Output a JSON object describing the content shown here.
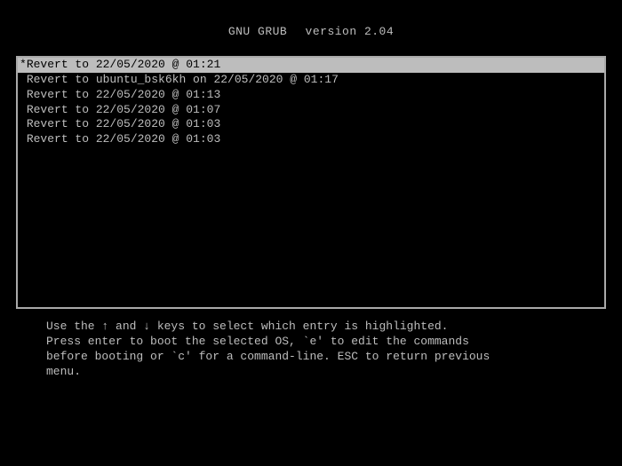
{
  "header": {
    "app": "GNU GRUB",
    "version_label": "version 2.04"
  },
  "menu": {
    "items": [
      {
        "marker": "*",
        "label": "Revert to 22/05/2020 @ 01:21",
        "selected": true
      },
      {
        "marker": " ",
        "label": "Revert to ubuntu_bsk6kh on 22/05/2020 @ 01:17",
        "selected": false
      },
      {
        "marker": " ",
        "label": "Revert to 22/05/2020 @ 01:13",
        "selected": false
      },
      {
        "marker": " ",
        "label": "Revert to 22/05/2020 @ 01:07",
        "selected": false
      },
      {
        "marker": " ",
        "label": "Revert to 22/05/2020 @ 01:03",
        "selected": false
      },
      {
        "marker": " ",
        "label": "Revert to 22/05/2020 @ 01:03",
        "selected": false
      }
    ]
  },
  "instructions": {
    "line1": "Use the ↑ and ↓ keys to select which entry is highlighted.",
    "line2": "Press enter to boot the selected OS, `e' to edit the commands",
    "line3": "before booting or `c' for a command-line. ESC to return previous",
    "line4": "menu."
  }
}
